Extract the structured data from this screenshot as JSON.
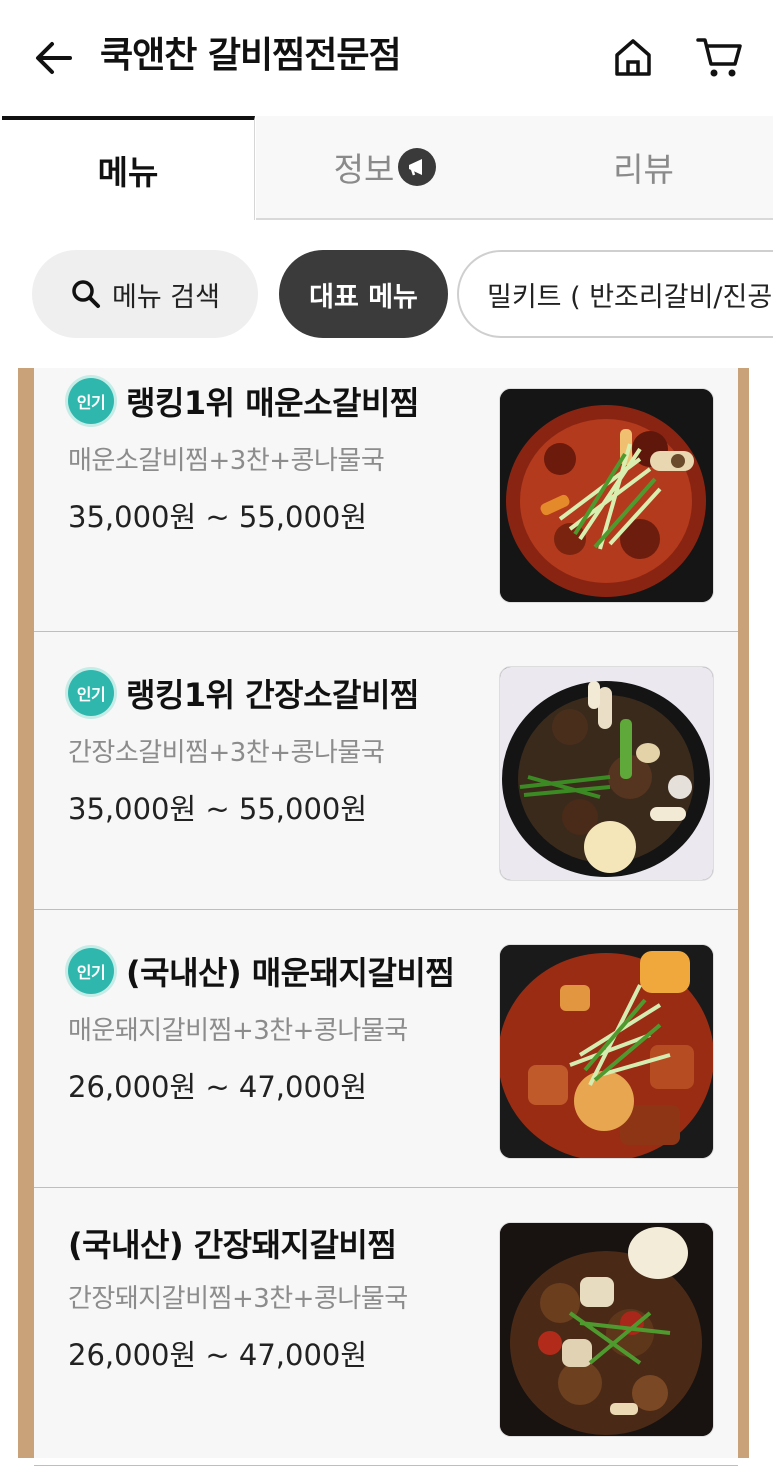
{
  "header": {
    "title": "쿡앤찬 갈비찜전문점",
    "back_icon": "arrow-left-icon",
    "home_icon": "home-icon",
    "cart_icon": "cart-icon"
  },
  "tabs": [
    {
      "label": "메뉴",
      "active": true
    },
    {
      "label": "정보",
      "active": false,
      "badge_icon": "megaphone-icon"
    },
    {
      "label": "리뷰",
      "active": false
    }
  ],
  "chips": {
    "search_label": "메뉴 검색",
    "active_label": "대표 메뉴",
    "mealkit_label": "밀키트 ( 반조리갈비/진공"
  },
  "menu_items": [
    {
      "badge": "인기",
      "name": "랭킹1위 매운소갈비찜",
      "desc": "매운소갈비찜+3찬+콩나물국",
      "price": "35,000원 ~ 55,000원",
      "image": "spicy-beef-galbijjim"
    },
    {
      "badge": "인기",
      "name": "랭킹1위 간장소갈비찜",
      "desc": "간장소갈비찜+3찬+콩나물국",
      "price": "35,000원 ~ 55,000원",
      "image": "soy-beef-galbijjim"
    },
    {
      "badge": "인기",
      "name": "(국내산) 매운돼지갈비찜",
      "desc": "매운돼지갈비찜+3찬+콩나물국",
      "price": "26,000원 ~ 47,000원",
      "image": "spicy-pork-galbijjim"
    },
    {
      "badge": "",
      "name": "(국내산) 간장돼지갈비찜",
      "desc": "간장돼지갈비찜+3찬+콩나물국",
      "price": "26,000원 ~ 47,000원",
      "image": "soy-pork-galbijjim"
    }
  ],
  "colors": {
    "accent_dark": "#3b3b3b",
    "popular_badge": "#2fb7ad",
    "frame_wood": "#c9a27a"
  }
}
